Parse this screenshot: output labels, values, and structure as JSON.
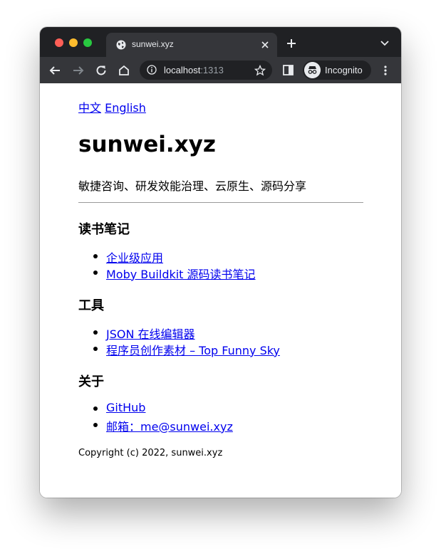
{
  "browser": {
    "tab_title": "sunwei.xyz",
    "url_host": "localhost",
    "url_port": ":1313",
    "profile_label": "Incognito"
  },
  "page": {
    "lang_zh": "中文",
    "lang_en": "English",
    "site_title": "sunwei.xyz",
    "tagline": "敏捷咨询、研发效能治理、云原生、源码分享",
    "sections": [
      {
        "heading": "读书笔记",
        "links": [
          "企业级应用",
          "Moby Buildkit 源码读书笔记"
        ]
      },
      {
        "heading": "工具",
        "links": [
          "JSON 在线编辑器",
          "程序员创作素材 – Top Funny Sky"
        ]
      },
      {
        "heading": "关于",
        "links": [
          "GitHub",
          "邮箱：me@sunwei.xyz"
        ]
      }
    ],
    "copyright": "Copyright (c) 2022, sunwei.xyz"
  },
  "colors": {
    "tabstrip_bg": "#202124",
    "toolbar_bg": "#35363a",
    "link": "#0000ee"
  }
}
